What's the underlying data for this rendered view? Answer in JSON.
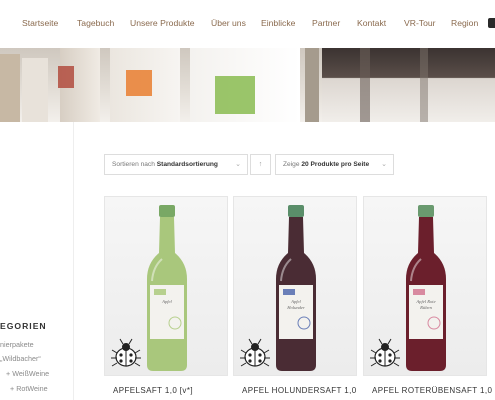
{
  "nav": {
    "items": [
      "Startseite",
      "Tagebuch",
      "Unsere Produkte",
      "Über uns",
      "Einblicke",
      "Partner",
      "Kontakt",
      "VR-Tour",
      "Region"
    ]
  },
  "toolbar": {
    "sort_prefix": "Sortieren nach",
    "sort_value": "Standardsortierung",
    "sort_dir_icon": "arrow-up-icon",
    "show_prefix": "Zeige",
    "show_value": "20 Produkte pro Seite"
  },
  "sidebar": {
    "heading": "EGORIEN",
    "items": [
      "nierpakete",
      "„Wildbacher“",
      "+ WeißWeine",
      "+ RotWeine"
    ]
  },
  "products": [
    {
      "title": "APFELSAFT 1,0 [v*]",
      "label": "Apfel",
      "liquid_color": "#a9c77c",
      "cap_color": "#79a865",
      "label_accent": "#b7d08e"
    },
    {
      "title": "APFEL HOLUNDERSAFT 1,0",
      "label": "Apfel Holunder",
      "liquid_color": "#4a2c34",
      "cap_color": "#5a8e6a",
      "label_accent": "#6a7fb8"
    },
    {
      "title": "APFEL ROTERÜBENSAFT 1,0",
      "label": "Apfel Rote Rüben",
      "liquid_color": "#6b1f2c",
      "cap_color": "#6a9a6f",
      "label_accent": "#d88aa0"
    }
  ],
  "colors": {
    "nav_text": "#8a6a4e",
    "border": "#dddddd"
  }
}
